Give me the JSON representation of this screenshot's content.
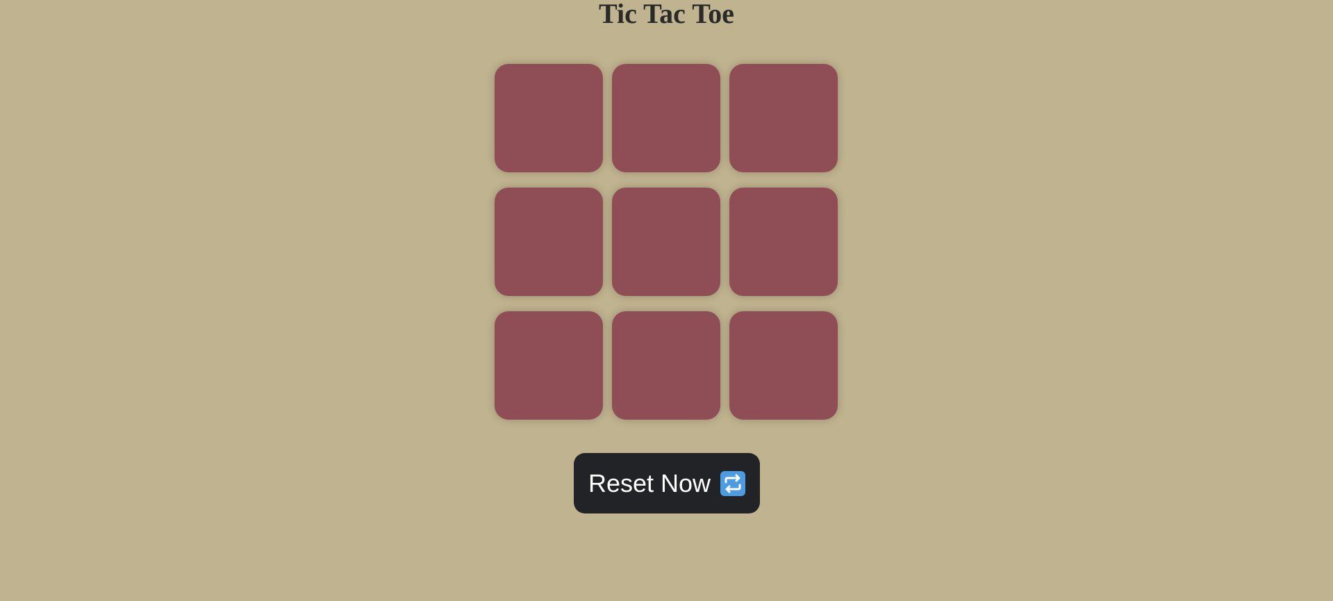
{
  "title": "Tic Tac Toe",
  "board": {
    "cells": [
      "",
      "",
      "",
      "",
      "",
      "",
      "",
      "",
      ""
    ]
  },
  "reset_button": {
    "label": "Reset Now",
    "icon": "repeat-icon"
  },
  "colors": {
    "background": "#c0b38f",
    "cell": "#8f4e55",
    "button": "#222326",
    "icon": "#4d9be0"
  }
}
